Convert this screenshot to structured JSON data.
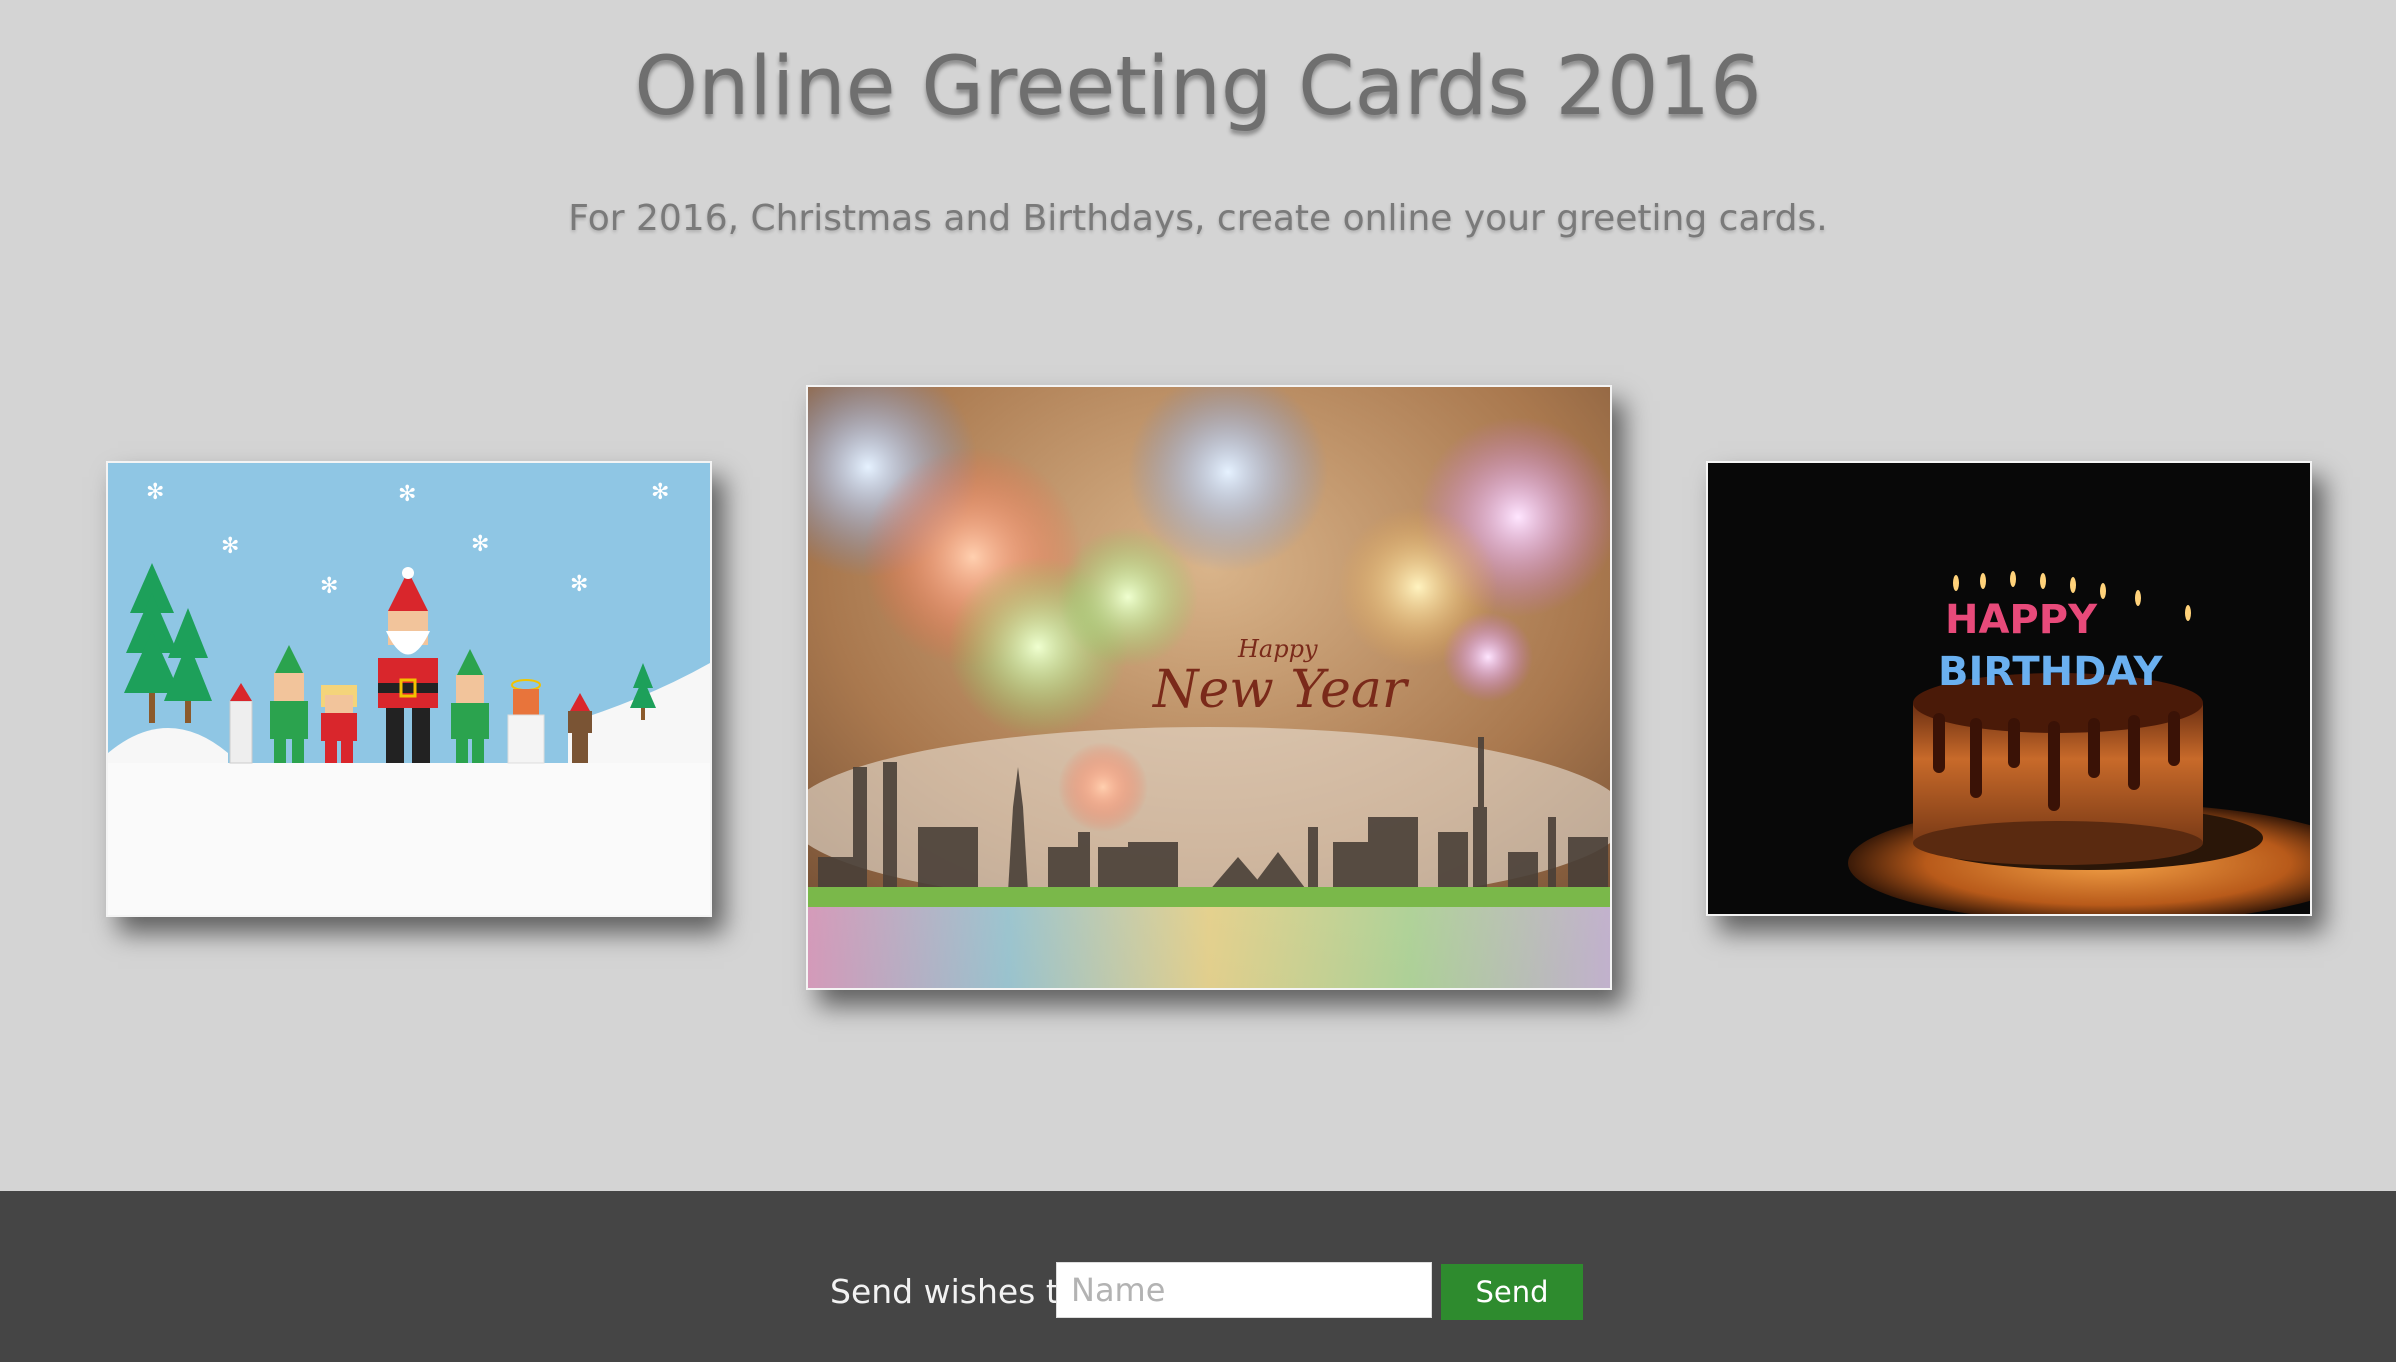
{
  "header": {
    "title": "Online Greeting Cards 2016",
    "subtitle": "For 2016, Christmas and Birthdays, create online your greeting cards."
  },
  "cards": [
    {
      "id": "christmas",
      "theme": "christmas-characters"
    },
    {
      "id": "newyear",
      "theme": "fireworks-skyline",
      "text_small": "Happy",
      "text_large": "New Year"
    },
    {
      "id": "birthday",
      "theme": "birthday-cake",
      "candle_text_top": "HAPPY",
      "candle_text_bottom": "BIRTHDAY"
    }
  ],
  "footer": {
    "label": "Send wishes to:",
    "name_placeholder": "Name",
    "name_value": "",
    "send_label": "Send",
    "send_color": "#2e8b2e",
    "background": "#454545"
  },
  "colors": {
    "page_background": "#d4d4d4",
    "title_color": "#6f6f6f"
  }
}
